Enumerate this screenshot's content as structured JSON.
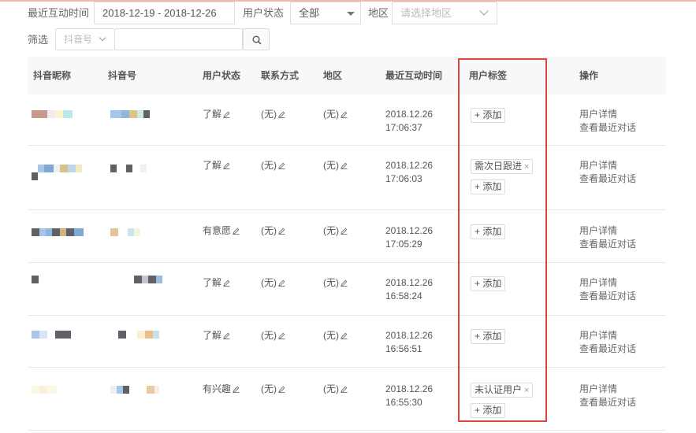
{
  "filters": {
    "recent_label": "最近互动时间",
    "date_range": "2018-12-19 - 2018-12-26",
    "status_label": "用户状态",
    "status_value": "全部",
    "region_label": "地区",
    "region_placeholder": "请选择地区",
    "screen_label": "筛选",
    "screen_select": "抖音号",
    "screen_input_value": ""
  },
  "table": {
    "headers": [
      "抖音昵称",
      "抖音号",
      "用户状态",
      "联系方式",
      "地区",
      "最近互动时间",
      "用户标签",
      "操作"
    ],
    "add_label": "+ 添加",
    "op_detail": "用户详情",
    "op_chat": "查看最近对话",
    "rows": [
      {
        "status": "了解",
        "contact": "(无)",
        "region": "(无)",
        "date": "2018.12.26",
        "time": "17:06:37",
        "tags": []
      },
      {
        "status": "了解",
        "contact": "(无)",
        "region": "(无)",
        "date": "2018.12.26",
        "time": "17:06:03",
        "tags": [
          "需次日跟进"
        ]
      },
      {
        "status": "有意愿",
        "contact": "(无)",
        "region": "(无)",
        "date": "2018.12.26",
        "time": "17:05:29",
        "tags": []
      },
      {
        "status": "了解",
        "contact": "(无)",
        "region": "(无)",
        "date": "2018.12.26",
        "time": "16:58:24",
        "tags": []
      },
      {
        "status": "了解",
        "contact": "(无)",
        "region": "(无)",
        "date": "2018.12.26",
        "time": "16:56:51",
        "tags": []
      },
      {
        "status": "有兴趣",
        "contact": "(无)",
        "region": "(无)",
        "date": "2018.12.26",
        "time": "16:55:30",
        "tags": [
          "未认证用户"
        ]
      }
    ]
  },
  "colors": {
    "highlight": "#e0443a",
    "header_bg": "#f7f8fa",
    "border": "#e8e8e8"
  },
  "icons": {
    "edit": "pencil-icon",
    "search": "search-icon",
    "dropdown": "chevron-down-icon",
    "remove_tag": "close-icon"
  }
}
